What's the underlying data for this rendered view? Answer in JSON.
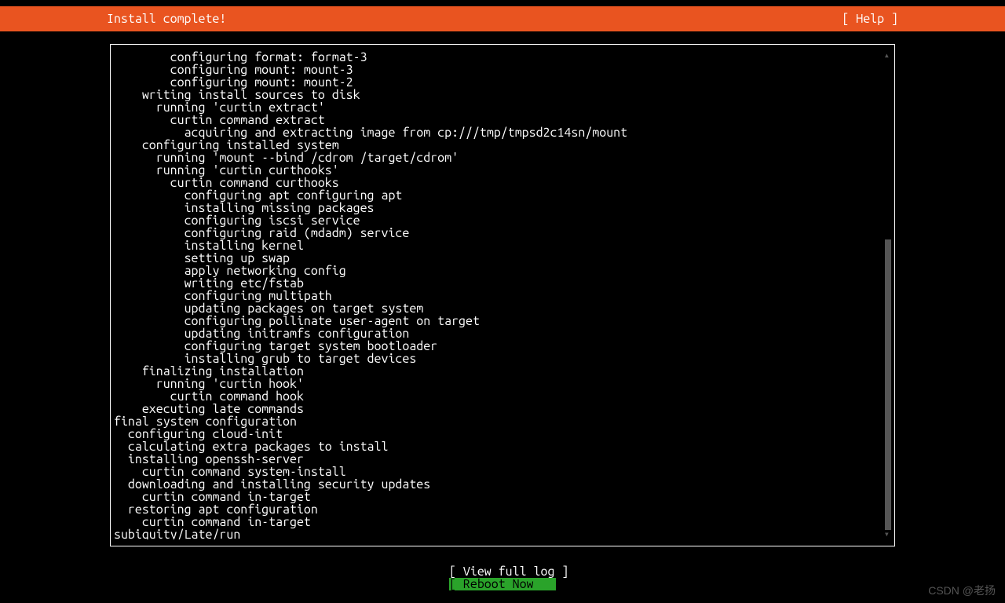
{
  "header": {
    "title": "Install complete!",
    "help": "[ Help ]"
  },
  "log": {
    "lines": [
      "        configuring format: format-3",
      "        configuring mount: mount-3",
      "        configuring mount: mount-2",
      "    writing install sources to disk",
      "      running 'curtin extract'",
      "        curtin command extract",
      "          acquiring and extracting image from cp:///tmp/tmpsd2c14sn/mount",
      "    configuring installed system",
      "      running 'mount --bind /cdrom /target/cdrom'",
      "      running 'curtin curthooks'",
      "        curtin command curthooks",
      "          configuring apt configuring apt",
      "          installing missing packages",
      "          configuring iscsi service",
      "          configuring raid (mdadm) service",
      "          installing kernel",
      "          setting up swap",
      "          apply networking config",
      "          writing etc/fstab",
      "          configuring multipath",
      "          updating packages on target system",
      "          configuring pollinate user-agent on target",
      "          updating initramfs configuration",
      "          configuring target system bootloader",
      "          installing grub to target devices",
      "    finalizing installation",
      "      running 'curtin hook'",
      "        curtin command hook",
      "    executing late commands",
      "final system configuration",
      "  configuring cloud-init",
      "  calculating extra packages to install",
      "  installing openssh-server",
      "    curtin command system-install",
      "  downloading and installing security updates",
      "    curtin command in-target",
      "  restoring apt configuration",
      "    curtin command in-target",
      "subiquity/Late/run"
    ]
  },
  "buttons": {
    "view_full_log": "[ View full log ]",
    "reboot_now": "[ Reboot Now    ]"
  },
  "watermark": "CSDN @老扬",
  "colors": {
    "accent": "#e95420",
    "highlight": "#2aa32a"
  }
}
